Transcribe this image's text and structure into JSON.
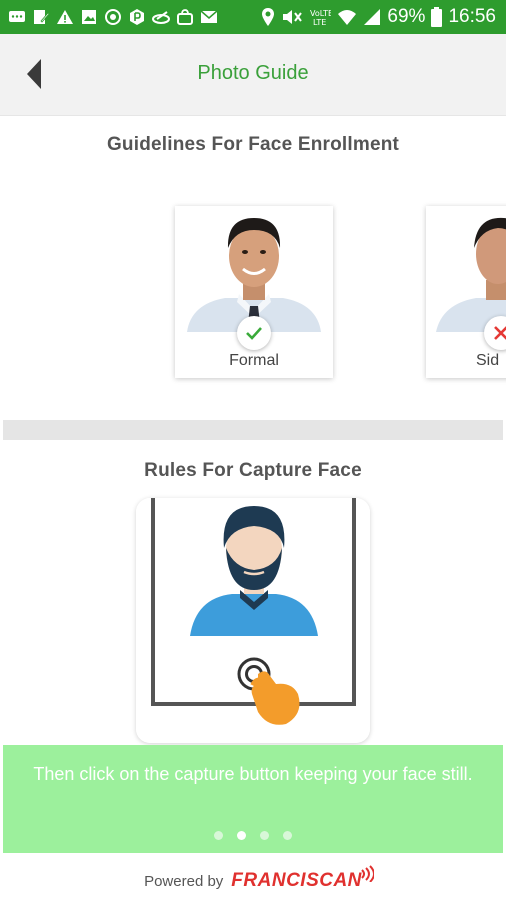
{
  "status_bar": {
    "battery": "69%",
    "time": "16:56",
    "icons": [
      "message-icon",
      "edit-icon",
      "warning-icon",
      "image-icon",
      "sync-icon",
      "parking-icon",
      "pen-icon",
      "bag-icon",
      "mail-icon",
      "location-icon",
      "mute-icon",
      "volte-icon",
      "wifi-icon",
      "signal-icon",
      "battery-icon"
    ],
    "color": "#2e9c2e"
  },
  "app_bar": {
    "title": "Photo Guide",
    "back_icon": "back-arrow-icon",
    "title_color": "#3aa03a"
  },
  "guidelines": {
    "title": "Guidelines For Face Enrollment",
    "cards": [
      {
        "label": "Formal",
        "status": "check",
        "status_icon": "check-icon"
      },
      {
        "label": "Sid",
        "status": "cross",
        "status_icon": "cross-icon"
      }
    ]
  },
  "rules": {
    "title": "Rules For Capture Face"
  },
  "tip": {
    "text": "Then click on the capture button keeping your face still.",
    "page_count": 4,
    "active_page": 2,
    "color": "#9cf09c"
  },
  "footer": {
    "powered_by": "Powered by",
    "brand": "FRANCISCAN",
    "brand_color": "#e0312f"
  }
}
